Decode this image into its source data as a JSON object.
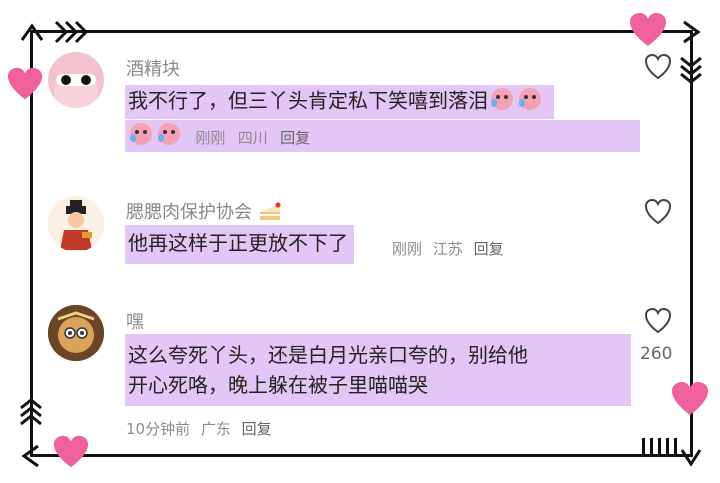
{
  "comments": [
    {
      "username": "酒精块",
      "text_line1": "我不行了，但三丫头肯定私下笑嘻到落泪",
      "emoji": "crying-laughing-emoji",
      "time": "刚刚",
      "location": "四川",
      "reply": "回复"
    },
    {
      "username": "腮腮肉保护协会",
      "username_emoji": "cake-emoji",
      "text_line1": "他再这样于正更放不下了",
      "time": "刚刚",
      "location": "江苏",
      "reply": "回复"
    },
    {
      "username": "嘿",
      "text_line1": "这么夸死丫头，还是白月光亲口夸的，别给他",
      "text_line2": "开心死咯，晚上躲在被子里喵喵哭",
      "time": "10分钟前",
      "location": "广东",
      "reply": "回复",
      "like_count": "260"
    }
  ],
  "colors": {
    "highlight": "#e2c6f5",
    "heart": "#f0609a",
    "frame": "#111111"
  }
}
